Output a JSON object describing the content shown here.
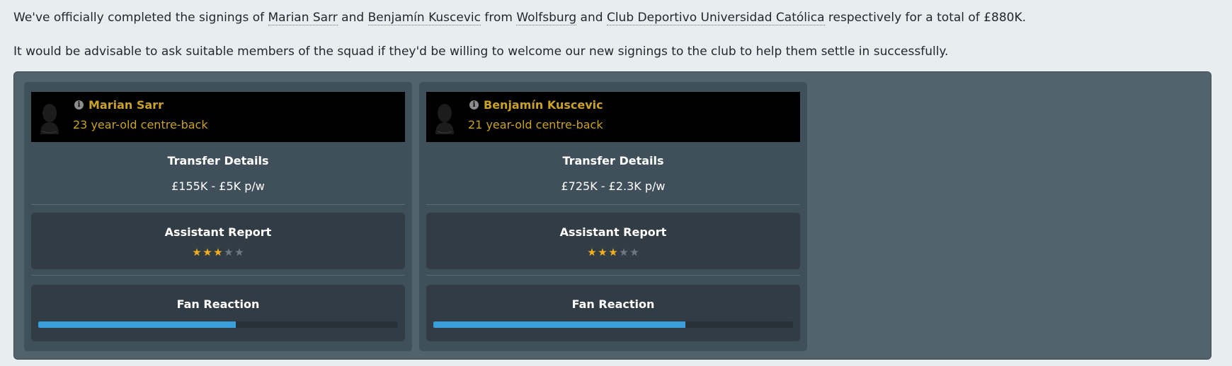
{
  "intro": {
    "p1_before": "We've officially completed the signings of ",
    "player1_link": "Marian Sarr",
    "and1": " and ",
    "player2_link": "Benjamín Kuscevic",
    "from": " from ",
    "club1_link": "Wolfsburg",
    "and2": " and ",
    "club2_link": "Club Deportivo Universidad Católica",
    "p1_after": " respectively for a total of £880K.",
    "p2": "It would be advisable to ask suitable members of the squad if they'd be willing to welcome our new signings to the club to help them settle in successfully."
  },
  "colors": {
    "accent_gold": "#c9a227",
    "star_on": "#f2b01e",
    "bar_fill": "#3aa0dc"
  },
  "cards": [
    {
      "name": "Marian Sarr",
      "description": "23 year-old centre-back",
      "transfer_title": "Transfer Details",
      "transfer_value": "£155K - £5K p/w",
      "assistant_title": "Assistant Report",
      "stars_rating": 3,
      "stars_max": 5,
      "fan_title": "Fan Reaction",
      "fan_reaction": 0.55
    },
    {
      "name": "Benjamín Kuscevic",
      "description": "21 year-old centre-back",
      "transfer_title": "Transfer Details",
      "transfer_value": "£725K - £2.3K p/w",
      "assistant_title": "Assistant Report",
      "stars_rating": 3,
      "stars_max": 5,
      "fan_title": "Fan Reaction",
      "fan_reaction": 0.7
    }
  ]
}
